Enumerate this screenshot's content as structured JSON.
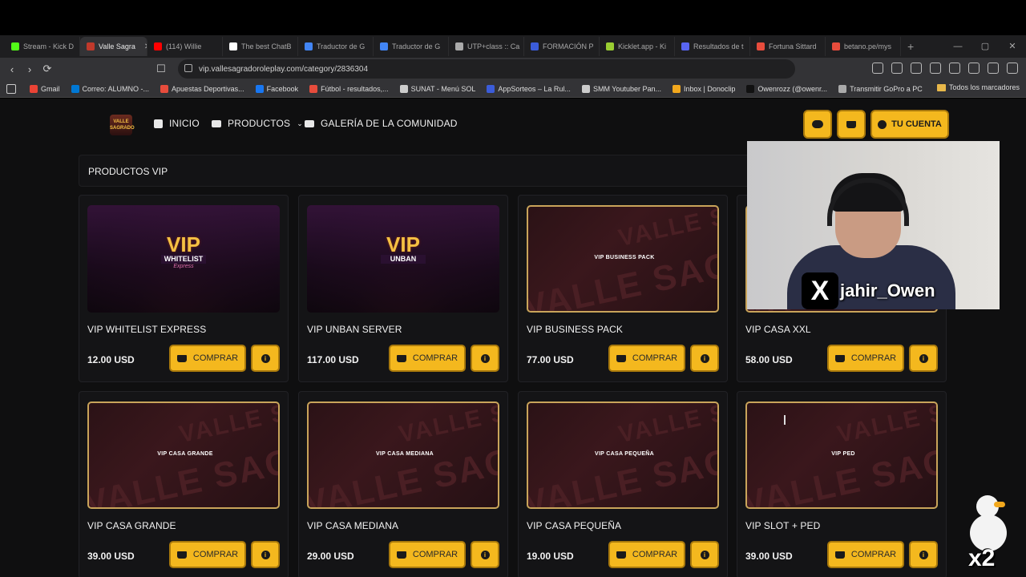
{
  "browser": {
    "tabs": [
      {
        "label": "Stream - Kick D",
        "color": "#53fc18"
      },
      {
        "label": "Valle Sagra",
        "color": "#c0392b",
        "active": true
      },
      {
        "label": "(114) Willie",
        "color": "#ff0000"
      },
      {
        "label": "The best ChatB",
        "color": "#ffffff"
      },
      {
        "label": "Traductor de G",
        "color": "#4285f4"
      },
      {
        "label": "Traductor de G",
        "color": "#4285f4"
      },
      {
        "label": "UTP+class :: Ca",
        "color": "#aaaaaa"
      },
      {
        "label": "FORMACIÓN P",
        "color": "#3b5cd9"
      },
      {
        "label": "Kicklet.app - Ki",
        "color": "#9acd32"
      },
      {
        "label": "Resultados de t",
        "color": "#5865f2"
      },
      {
        "label": "Fortuna Sittard",
        "color": "#e74c3c"
      },
      {
        "label": "betano.pe/mys",
        "color": "#e74c3c"
      }
    ],
    "url": "vip.vallesagradoroleplay.com/category/2836304",
    "bookmarks": [
      {
        "label": "Gmail",
        "color": "#ea4335"
      },
      {
        "label": "Correo: ALUMNO -...",
        "color": "#0078d4"
      },
      {
        "label": "Apuestas Deportivas...",
        "color": "#e74c3c"
      },
      {
        "label": "Facebook",
        "color": "#1877f2"
      },
      {
        "label": "Fútbol - resultados,...",
        "color": "#e74c3c"
      },
      {
        "label": "SUNAT - Menú SOL",
        "color": "#cccccc"
      },
      {
        "label": "AppSorteos – La Rul...",
        "color": "#3b5cd9"
      },
      {
        "label": "SMM Youtuber Pan...",
        "color": "#cccccc"
      },
      {
        "label": "Inbox | Donoclip",
        "color": "#f2a81d"
      },
      {
        "label": "Owenrozz (@owenr...",
        "color": "#111111"
      },
      {
        "label": "Transmitir GoPro a PC",
        "color": "#aaaaaa"
      }
    ],
    "all_bookmarks": "Todos los marcadores"
  },
  "site": {
    "logo_text": "VALLE SAGRADO",
    "nav": {
      "home": "INICIO",
      "products": "PRODUCTOS",
      "gallery": "GALERÍA DE LA COMUNIDAD",
      "account": "TU CUENTA"
    },
    "section_title": "PRODUCTOS VIP",
    "buy_label": "COMPRAR",
    "products": [
      {
        "name": "VIP WHITELIST EXPRESS",
        "price": "12.00 USD",
        "thumb": "vip",
        "badge": "VIP",
        "sub": "WHITELIST",
        "tag": "Express"
      },
      {
        "name": "VIP UNBAN SERVER",
        "price": "117.00 USD",
        "thumb": "vip",
        "badge": "VIP",
        "sub": "UNBAN",
        "tag": ""
      },
      {
        "name": "VIP BUSINESS PACK",
        "price": "77.00 USD",
        "thumb": "brand",
        "label": "VIP BUSINESS PACK"
      },
      {
        "name": "VIP CASA XXL",
        "price": "58.00 USD",
        "thumb": "brand",
        "label": ""
      },
      {
        "name": "VIP CASA GRANDE",
        "price": "39.00 USD",
        "thumb": "brand",
        "label": "VIP CASA GRANDE"
      },
      {
        "name": "VIP CASA MEDIANA",
        "price": "29.00 USD",
        "thumb": "brand",
        "label": "VIP CASA MEDIANA"
      },
      {
        "name": "VIP CASA PEQUEÑA",
        "price": "19.00 USD",
        "thumb": "brand",
        "label": "VIP CASA PEQUEÑA"
      },
      {
        "name": "VIP SLOT + PED",
        "price": "39.00 USD",
        "thumb": "brand",
        "label": "VIP PED"
      }
    ],
    "watermark": "VALLE SAGRADO"
  },
  "overlay": {
    "x_handle": "jahir_Owen",
    "multiplier": "x2"
  }
}
